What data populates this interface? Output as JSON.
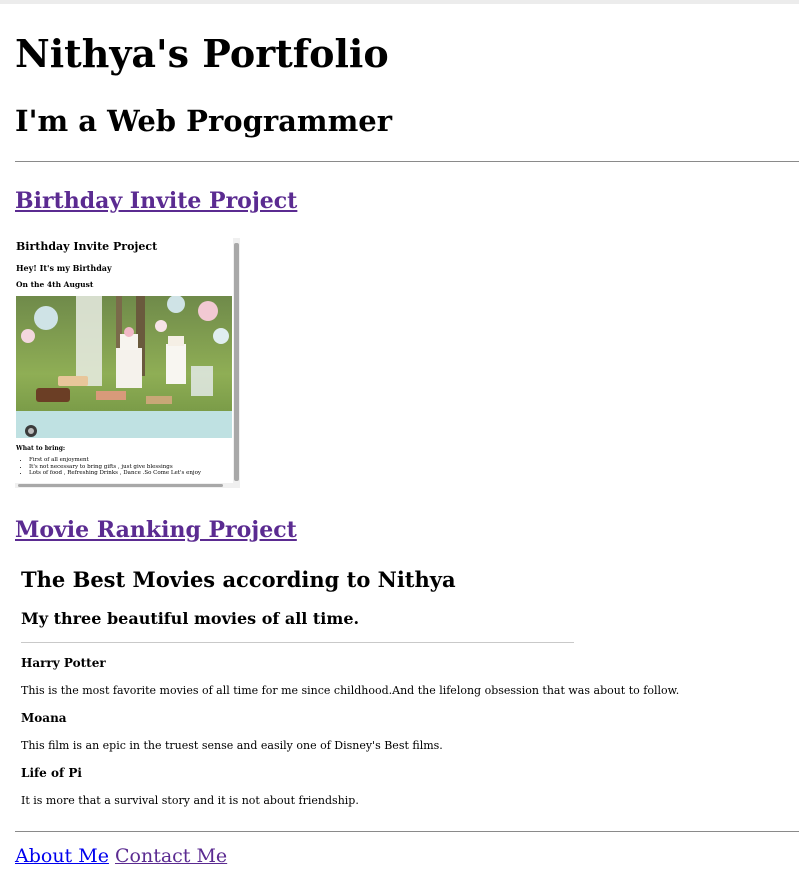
{
  "header": {
    "title": "Nithya's Portfolio",
    "subtitle": "I'm a Web Programmer"
  },
  "projects": [
    {
      "link_label": "Birthday Invite Project",
      "preview": {
        "title": "Birthday Invite Project",
        "heading": "Hey! It's my Birthday",
        "date": "On the 4th August",
        "bring_label": "What to bring:",
        "items": [
          "First of all enjoyment",
          "It's not necessary to bring gifts , just give blessings",
          "Lots of food , Refreshing Drinks , Dance .So Come Let's enjoy"
        ]
      }
    },
    {
      "link_label": "Movie Ranking Project",
      "preview": {
        "title": "The Best Movies according to Nithya",
        "subtitle": "My three beautiful movies of all time.",
        "movies": [
          {
            "name": "Harry Potter",
            "desc": "This is the most favorite movies of all time for me since childhood.And the lifelong obsession that was about to follow."
          },
          {
            "name": "Moana",
            "desc": "This film is an epic in the truest sense and easily one of Disney's Best films."
          },
          {
            "name": "Life of Pi",
            "desc": "It is more that a survival story and it is not about friendship."
          }
        ]
      }
    }
  ],
  "footer": {
    "about_label": "About Me",
    "contact_label": "Contact Me"
  },
  "colors": {
    "visited_link": "#5b2b91",
    "link": "#0000ee"
  }
}
